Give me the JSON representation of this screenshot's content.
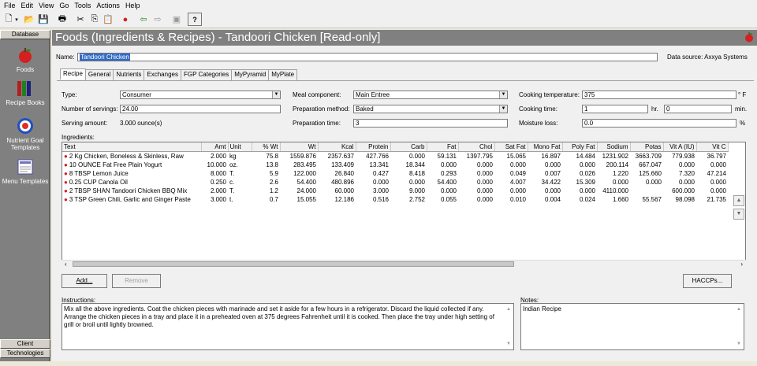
{
  "menubar": [
    "File",
    "Edit",
    "View",
    "Go",
    "Tools",
    "Actions",
    "Help"
  ],
  "sidebar": {
    "header": "Database",
    "items": [
      {
        "label": "Foods",
        "icon": "apple-icon"
      },
      {
        "label": "Recipe Books",
        "icon": "books-icon"
      },
      {
        "label": "Nutrient Goal Templates",
        "icon": "target-icon"
      },
      {
        "label": "Menu Templates",
        "icon": "menu-icon"
      }
    ],
    "footer1": "Client",
    "footer2": "Technologies"
  },
  "window_title": "Foods (Ingredients & Recipes) - Tandoori Chicken [Read-only]",
  "name_label": "Name:",
  "name_value": "Tandoori Chicken",
  "data_source": "Data source:  Axxya Systems",
  "tabs": [
    "Recipe",
    "General",
    "Nutrients",
    "Exchanges",
    "FGP Categories",
    "MyPyramid",
    "MyPlate"
  ],
  "form": {
    "type_label": "Type:",
    "type_value": "Consumer",
    "servings_label": "Number of servings:",
    "servings_value": "24.00",
    "serving_amount_label": "Serving amount:",
    "serving_amount_value": "3.000 ounce(s)",
    "meal_label": "Meal component:",
    "meal_value": "Main Entree",
    "prep_method_label": "Preparation method:",
    "prep_method_value": "Baked",
    "prep_time_label": "Preparation time:",
    "prep_time_value": "3",
    "cook_temp_label": "Cooking temperature:",
    "cook_temp_value": "375",
    "cook_temp_unit": "° F",
    "cook_time_label": "Cooking time:",
    "cook_time_hr": "1",
    "hr_label": "hr.",
    "cook_time_min": "0",
    "min_label": "min.",
    "moisture_label": "Moisture loss:",
    "moisture_value": "0.0",
    "moisture_unit": "%"
  },
  "ingredients_label": "Ingredients:",
  "columns": [
    "Text",
    "Amt",
    "Unit",
    "% Wt",
    "Wt",
    "Kcal",
    "Protein",
    "Carb",
    "Fat",
    "Chol",
    "Sat Fat",
    "Mono Fat",
    "Poly Fat",
    "Sodium",
    "Potas",
    "Vit A (IU)",
    "Vit C"
  ],
  "rows": [
    [
      "2 Kg Chicken, Boneless & Skinless, Raw",
      "2.000",
      "kg",
      "75.8",
      "1559.876",
      "2357.637",
      "427.766",
      "0.000",
      "59.131",
      "1397.795",
      "15.065",
      "16.897",
      "14.484",
      "1231.902",
      "3663.709",
      "779.938",
      "36.797"
    ],
    [
      "10 OUNCE Fat Free Plain Yogurt",
      "10.000",
      "oz.",
      "13.8",
      "283.495",
      "133.409",
      "13.341",
      "18.344",
      "0.000",
      "0.000",
      "0.000",
      "0.000",
      "0.000",
      "200.114",
      "667.047",
      "0.000",
      "0.000"
    ],
    [
      "8 TBSP Lemon Juice",
      "8.000",
      "T.",
      "5.9",
      "122.000",
      "26.840",
      "0.427",
      "8.418",
      "0.293",
      "0.000",
      "0.049",
      "0.007",
      "0.026",
      "1.220",
      "125.660",
      "7.320",
      "47.214"
    ],
    [
      "0.25 CUP Canola Oil",
      "0.250",
      "c.",
      "2.6",
      "54.400",
      "480.896",
      "0.000",
      "0.000",
      "54.400",
      "0.000",
      "4.007",
      "34.422",
      "15.309",
      "0.000",
      "0.000",
      "0.000",
      "0.000"
    ],
    [
      "2 TBSP SHAN Tandoori Chicken BBQ Mix",
      "2.000",
      "T.",
      "1.2",
      "24.000",
      "60.000",
      "3.000",
      "9.000",
      "0.000",
      "0.000",
      "0.000",
      "0.000",
      "0.000",
      "4110.000",
      "",
      "600.000",
      "0.000"
    ],
    [
      "3 TSP Green Chili, Garlic and Ginger Paste",
      "3.000",
      "t.",
      "0.7",
      "15.055",
      "12.186",
      "0.516",
      "2.752",
      "0.055",
      "0.000",
      "0.010",
      "0.004",
      "0.024",
      "1.660",
      "55.567",
      "98.098",
      "21.735"
    ]
  ],
  "buttons": {
    "add": "Add...",
    "remove": "Remove",
    "haccp": "HACCPs..."
  },
  "instructions_label": "Instructions:",
  "instructions": "Mix all the above ingredients.  Coat the chicken pieces with marinade and set it aside for a few hours in a refrigerator.  Discard the liquid collected if any.  Arrange the chicken pieces in a tray and place it in a preheated oven at 375 degrees Fahrenheit until it is cooked.  Then place the tray under high setting of grill or broil until lightly browned.",
  "notes_label": "Notes:",
  "notes": "Indian Recipe",
  "colors": {
    "title_bg": "#808080",
    "sidebar_bg": "#808080",
    "selection": "#316ac5",
    "apple": "#d42020"
  }
}
